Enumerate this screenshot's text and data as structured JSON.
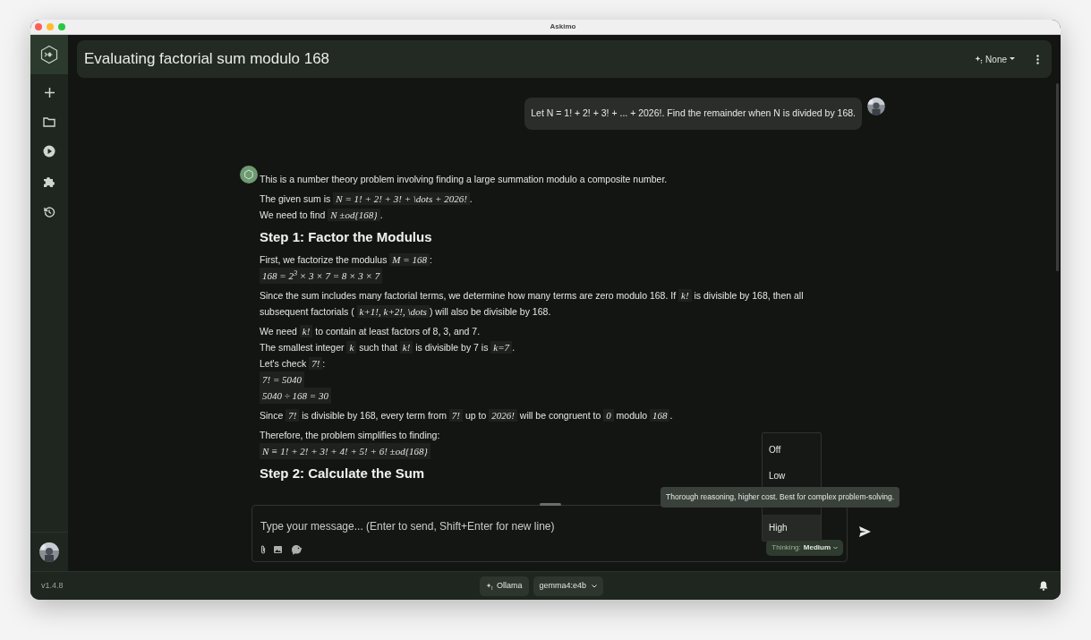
{
  "window": {
    "title": "Askimo"
  },
  "header": {
    "title": "Evaluating factorial sum modulo 168",
    "model_button": "None"
  },
  "user_message": {
    "text": "Let N = 1! + 2! + 3! + ... + 2026!. Find the remainder when N is divided by 168."
  },
  "answer": [
    {
      "kind": "para",
      "lines": [
        [
          {
            "kind": "text",
            "text": "This is a number theory problem involving finding a large summation modulo a composite number."
          }
        ]
      ]
    },
    {
      "kind": "para",
      "lines": [
        [
          {
            "kind": "text",
            "text": "The given sum is"
          },
          {
            "kind": "math",
            "text": "N = 1! + 2! + 3! + \\dots + 2026!"
          },
          {
            "kind": "text",
            "text": "."
          }
        ],
        [
          {
            "kind": "text",
            "text": "We need to find"
          },
          {
            "kind": "math",
            "text": "N ±od{168}"
          },
          {
            "kind": "text",
            "text": "."
          }
        ]
      ]
    },
    {
      "kind": "heading",
      "text": "Step 1: Factor the Modulus"
    },
    {
      "kind": "para",
      "lines": [
        [
          {
            "kind": "text",
            "text": "First, we factorize the modulus"
          },
          {
            "kind": "math",
            "text": "M = 168"
          },
          {
            "kind": "text",
            "text": ":"
          }
        ],
        [
          {
            "kind": "math",
            "text": "168 = 2$^{3}$ × 3 × 7 = 8 × 3 × 7"
          }
        ]
      ]
    },
    {
      "kind": "para",
      "lines": [
        [
          {
            "kind": "text",
            "text": "Since the sum includes many factorial terms, we determine how many terms are zero modulo 168. If"
          },
          {
            "kind": "math",
            "text": "k!"
          },
          {
            "kind": "text",
            "text": "is divisible by 168, then all subsequent factorials ("
          },
          {
            "kind": "math",
            "text": "k+1!, k+2!, \\dots"
          },
          {
            "kind": "text",
            "text": ") will also be divisible by 168."
          }
        ]
      ]
    },
    {
      "kind": "para",
      "lines": [
        [
          {
            "kind": "text",
            "text": "We need"
          },
          {
            "kind": "math",
            "text": "k!"
          },
          {
            "kind": "text",
            "text": "to contain at least factors of 8, 3, and 7."
          }
        ],
        [
          {
            "kind": "text",
            "text": "The smallest integer"
          },
          {
            "kind": "math",
            "text": "k"
          },
          {
            "kind": "text",
            "text": "such that"
          },
          {
            "kind": "math",
            "text": "k!"
          },
          {
            "kind": "text",
            "text": "is divisible by 7 is"
          },
          {
            "kind": "math",
            "text": "k=7"
          },
          {
            "kind": "text",
            "text": "."
          }
        ],
        [
          {
            "kind": "text",
            "text": "Let's check"
          },
          {
            "kind": "math",
            "text": "7!"
          },
          {
            "kind": "text",
            "text": ":"
          }
        ],
        [
          {
            "kind": "math",
            "text": "7! = 5040"
          }
        ],
        [
          {
            "kind": "math",
            "text": "5040 ÷ 168 = 30"
          }
        ]
      ]
    },
    {
      "kind": "para",
      "lines": [
        [
          {
            "kind": "text",
            "text": "Since"
          },
          {
            "kind": "math",
            "text": "7!"
          },
          {
            "kind": "text",
            "text": "is divisible by 168, every term from"
          },
          {
            "kind": "math",
            "text": "7!"
          },
          {
            "kind": "text",
            "text": "up to"
          },
          {
            "kind": "math",
            "text": "2026!"
          },
          {
            "kind": "text",
            "text": "will be congruent to"
          },
          {
            "kind": "math",
            "text": "0"
          },
          {
            "kind": "text",
            "text": "modulo"
          },
          {
            "kind": "math",
            "text": "168"
          },
          {
            "kind": "text",
            "text": "."
          }
        ]
      ]
    },
    {
      "kind": "para",
      "lines": [
        [
          {
            "kind": "text",
            "text": "Therefore, the problem simplifies to finding:"
          }
        ],
        [
          {
            "kind": "math",
            "text": "N ≡ 1! + 2! + 3! + 4! + 5! + 6! ±od{168}"
          }
        ]
      ]
    },
    {
      "kind": "heading",
      "text": "Step 2: Calculate the Sum"
    }
  ],
  "composer": {
    "placeholder": "Type your message... (Enter to send, Shift+Enter for new line)",
    "thinking_label": "Thinking:",
    "thinking_value": "Medium"
  },
  "thinking_menu": [
    {
      "label": "Off",
      "highlighted": false
    },
    {
      "label": "Low",
      "highlighted": false
    },
    {
      "label": "High",
      "highlighted": true
    }
  ],
  "tooltip": "Thorough reasoning, higher cost. Best for complex problem-solving.",
  "status_bar": {
    "version": "v1.4.8",
    "provider": "Ollama",
    "model": "gemma4:e4b"
  }
}
